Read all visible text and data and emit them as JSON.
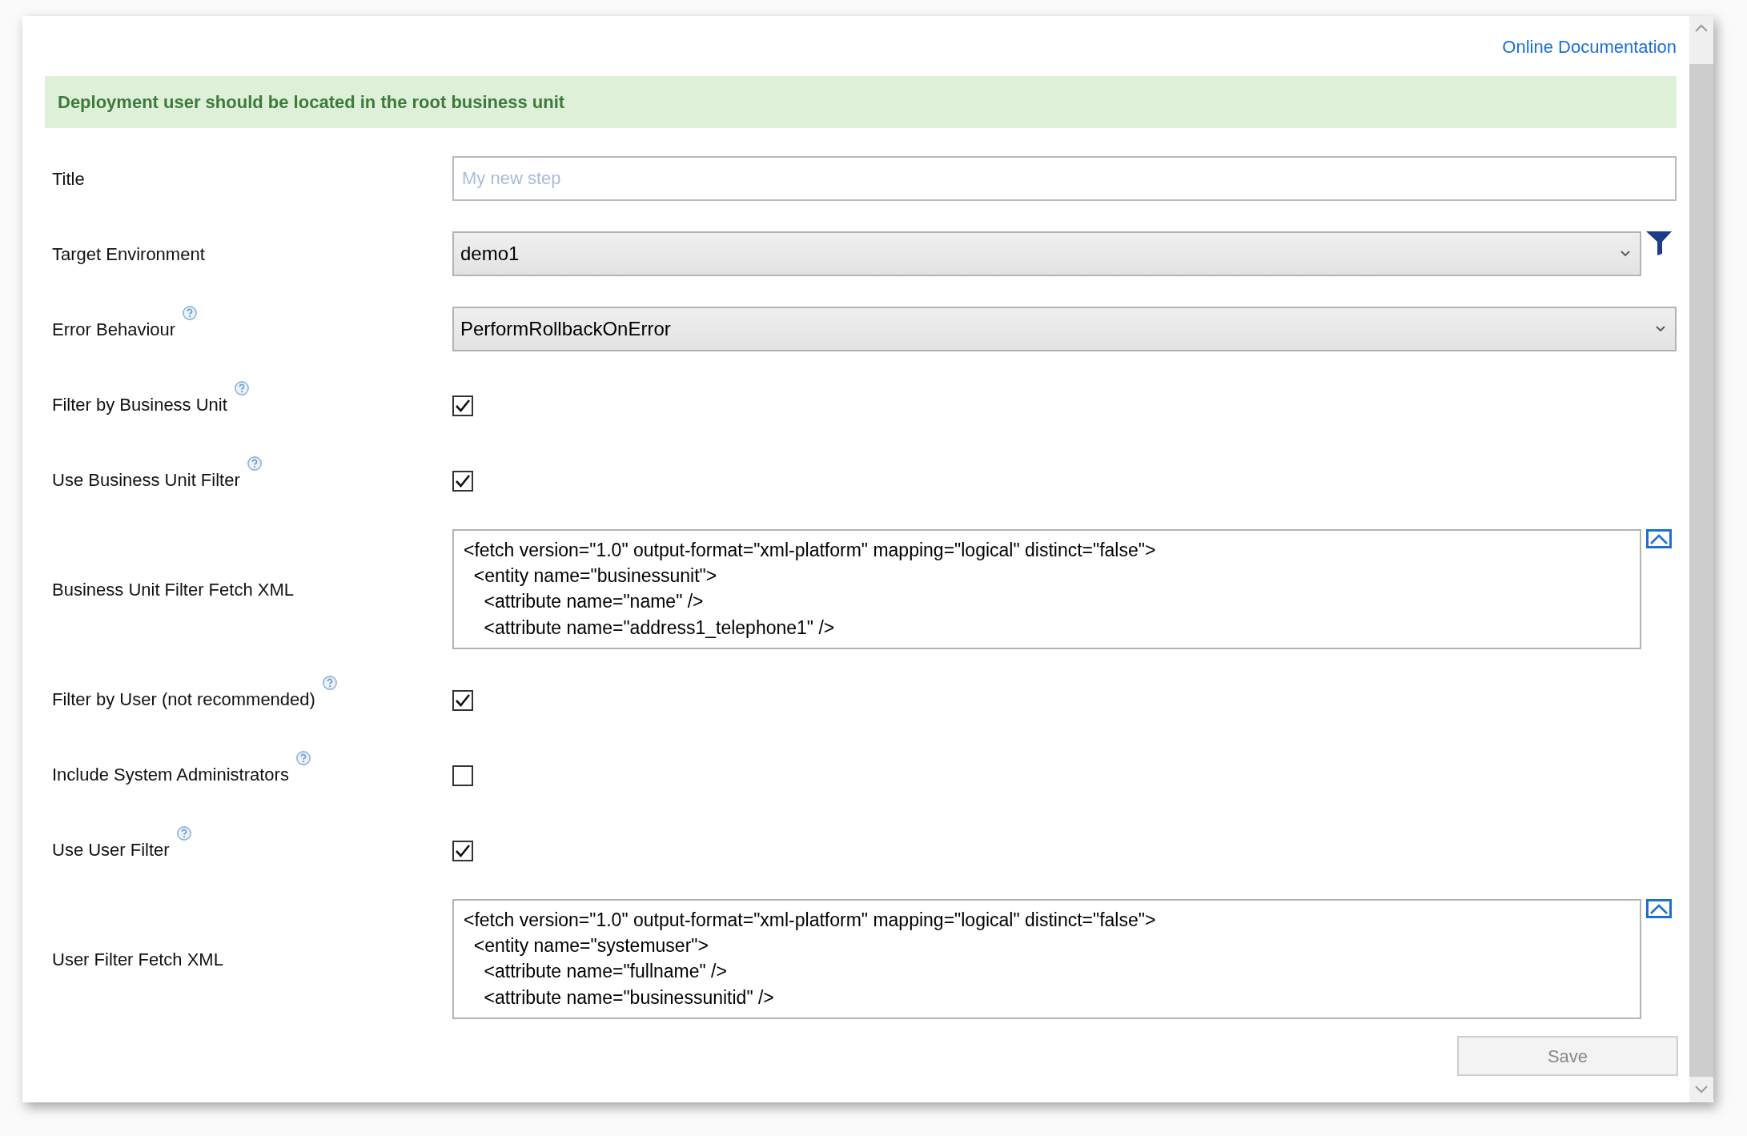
{
  "link": "Online Documentation",
  "banner": "Deployment user should be located in the root business unit",
  "fields": [
    {
      "kind": "text",
      "label": "Title",
      "help": false,
      "placeholder": "My new step"
    },
    {
      "kind": "select",
      "label": "Target Environment",
      "help": false,
      "value": "demo1",
      "filter": true
    },
    {
      "kind": "select",
      "label": "Error Behaviour",
      "help": true,
      "value": "PerformRollbackOnError",
      "filter": false
    },
    {
      "kind": "checkbox",
      "label": "Filter by Business Unit",
      "help": true,
      "checked": true
    },
    {
      "kind": "checkbox",
      "label": "Use Business Unit Filter",
      "help": true,
      "checked": true
    },
    {
      "kind": "xml",
      "label": "Business Unit Filter Fetch XML",
      "help": false,
      "lines": [
        "<fetch version=\"1.0\" output-format=\"xml-platform\" mapping=\"logical\" distinct=\"false\">",
        "  <entity name=\"businessunit\">",
        "    <attribute name=\"name\" />",
        "    <attribute name=\"address1_telephone1\" />"
      ]
    },
    {
      "kind": "checkbox",
      "label": "Filter by User (not recommended)",
      "help": true,
      "checked": true
    },
    {
      "kind": "checkbox",
      "label": "Include System Administrators",
      "help": true,
      "checked": false
    },
    {
      "kind": "checkbox",
      "label": "Use User Filter",
      "help": true,
      "checked": true
    },
    {
      "kind": "xml",
      "label": "User Filter Fetch XML",
      "help": false,
      "lines": [
        "<fetch version=\"1.0\" output-format=\"xml-platform\" mapping=\"logical\" distinct=\"false\">",
        "  <entity name=\"systemuser\">",
        "    <attribute name=\"fullname\" />",
        "    <attribute name=\"businessunitid\" />"
      ]
    }
  ],
  "save": {
    "label": "Save",
    "disabled": true
  }
}
